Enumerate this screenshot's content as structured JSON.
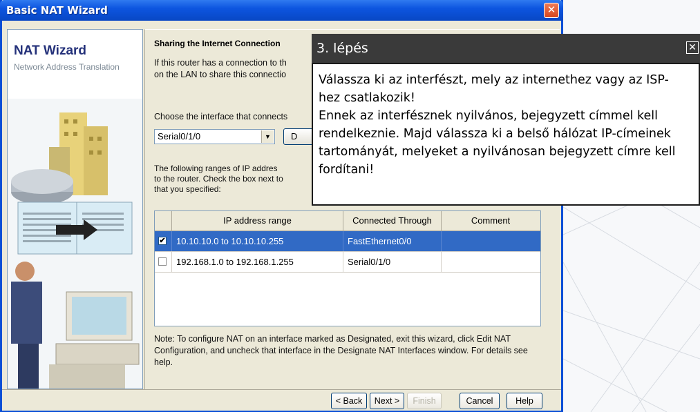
{
  "window": {
    "title": "Basic NAT Wizard",
    "close_glyph": "✕"
  },
  "left_panel": {
    "title": "NAT Wizard",
    "subtitle": "Network Address Translation"
  },
  "content": {
    "section_title": "Sharing the Internet Connection",
    "intro_line1": "If this router has a connection to th",
    "intro_line2": "on the LAN to share this connectio",
    "choose_label": "Choose the interface that connects",
    "interface_select": "Serial0/1/0",
    "details_button": "D",
    "ranges_line1": "The following ranges of IP addres",
    "ranges_line2": "to the router. Check the box next to",
    "ranges_line3": "that you specified:",
    "table": {
      "headers": [
        "IP address range",
        "Connected Through",
        "Comment"
      ],
      "rows": [
        {
          "checked": true,
          "check_glyph": "✔",
          "range": "10.10.10.0 to 10.10.10.255",
          "through": "FastEthernet0/0",
          "comment": ""
        },
        {
          "checked": false,
          "check_glyph": "",
          "range": "192.168.1.0 to 192.168.1.255",
          "through": "Serial0/1/0",
          "comment": ""
        }
      ]
    },
    "note": "Note: To configure NAT on an interface marked as Designated, exit this wizard, click Edit NAT Configuration, and uncheck that interface in the Designate NAT Interfaces window. For details see help."
  },
  "buttons": {
    "back": "< Back",
    "next": "Next >",
    "finish": "Finish",
    "cancel": "Cancel",
    "help": "Help"
  },
  "popup": {
    "title": "3. lépés",
    "close_glyph": "✕",
    "body_line1": "Válassza ki az interfészt, mely az internethez vagy az ISP-",
    "body_line2": "hez csatlakozik!",
    "body_line3": "Ennek az interfésznek nyilvános, bejegyzett címmel kell",
    "body_line4": "rendelkeznie. Majd válassza ki a belső hálózat IP-címeinek",
    "body_line5": "tartományát, melyeket a nyilvánosan bejegyzett címre kell",
    "body_line6": "fordítani!"
  },
  "colors": {
    "titlebar": "#0d55e0",
    "selection": "#316ac5",
    "popup_header": "#3a3a3a"
  }
}
